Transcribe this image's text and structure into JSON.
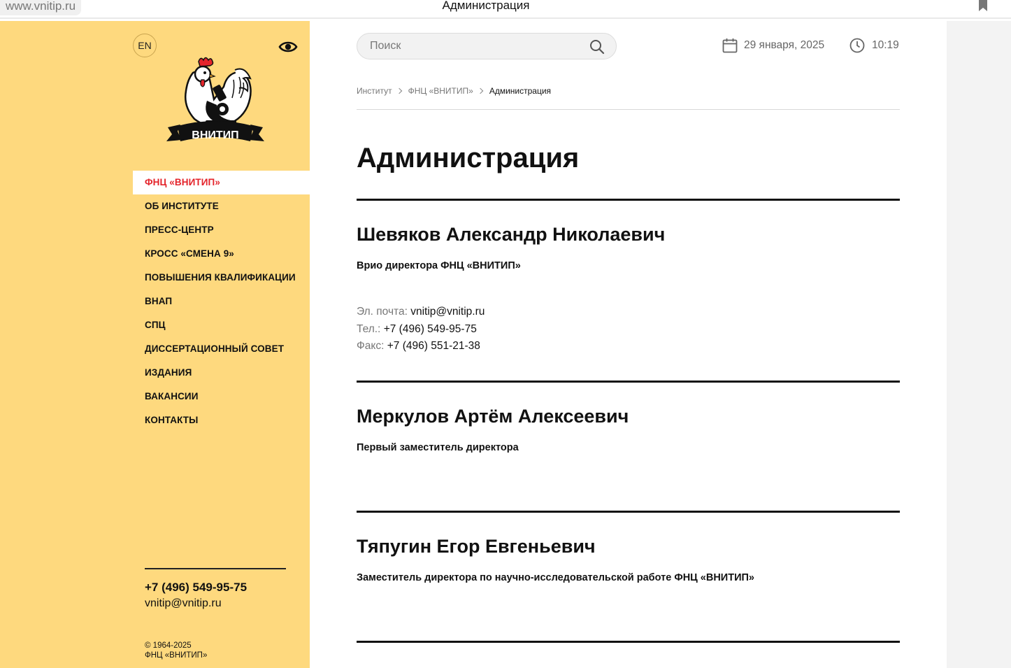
{
  "browser": {
    "url": "www.vnitip.ru",
    "tab_title": "Администрация"
  },
  "sidebar": {
    "lang_label": "EN",
    "logo_text": "ВНИТИП",
    "nav": [
      {
        "label": "ФНЦ «ВНИТИП»",
        "active": true
      },
      {
        "label": "ОБ ИНСТИТУТЕ"
      },
      {
        "label": "ПРЕСС-ЦЕНТР"
      },
      {
        "label": "КРОСС «СМЕНА 9»"
      },
      {
        "label": "ПОВЫШЕНИЯ КВАЛИФИКАЦИИ"
      },
      {
        "label": "ВНАП"
      },
      {
        "label": "СПЦ"
      },
      {
        "label": "ДИССЕРТАЦИОННЫЙ СОВЕТ"
      },
      {
        "label": "ИЗДАНИЯ"
      },
      {
        "label": "ВАКАНСИИ"
      },
      {
        "label": "КОНТАКТЫ"
      }
    ],
    "phone": "+7 (496) 549-95-75",
    "email": "vnitip@vnitip.ru",
    "copyright_years": "© 1964-2025",
    "copyright_org": "ФНЦ «ВНИТИП»"
  },
  "header": {
    "search_placeholder": "Поиск",
    "date": "29 января, 2025",
    "time": "10:19"
  },
  "breadcrumb": [
    "Институт",
    "ФНЦ «ВНИТИП»",
    "Администрация"
  ],
  "page_title": "Администрация",
  "people": [
    {
      "name": "Шевяков Александр Николаевич",
      "role": "Врио директора ФНЦ «ВНИТИП»",
      "contacts": [
        {
          "label": "Эл. почта:",
          "value": "vnitip@vnitip.ru"
        },
        {
          "label": "Тел.:",
          "value": "+7 (496) 549-95-75"
        },
        {
          "label": "Факс:",
          "value": "+7 (496) 551-21-38"
        }
      ]
    },
    {
      "name": "Меркулов Артём Алексеевич",
      "role": "Первый заместитель директора"
    },
    {
      "name": "Тяпугин Егор Евгеньевич",
      "role": "Заместитель директора по научно-исследовательской работе ФНЦ «ВНИТИП»"
    }
  ],
  "colors": {
    "sidebar_bg": "#fed97e",
    "accent_red": "#e4242b",
    "text": "#111111"
  }
}
